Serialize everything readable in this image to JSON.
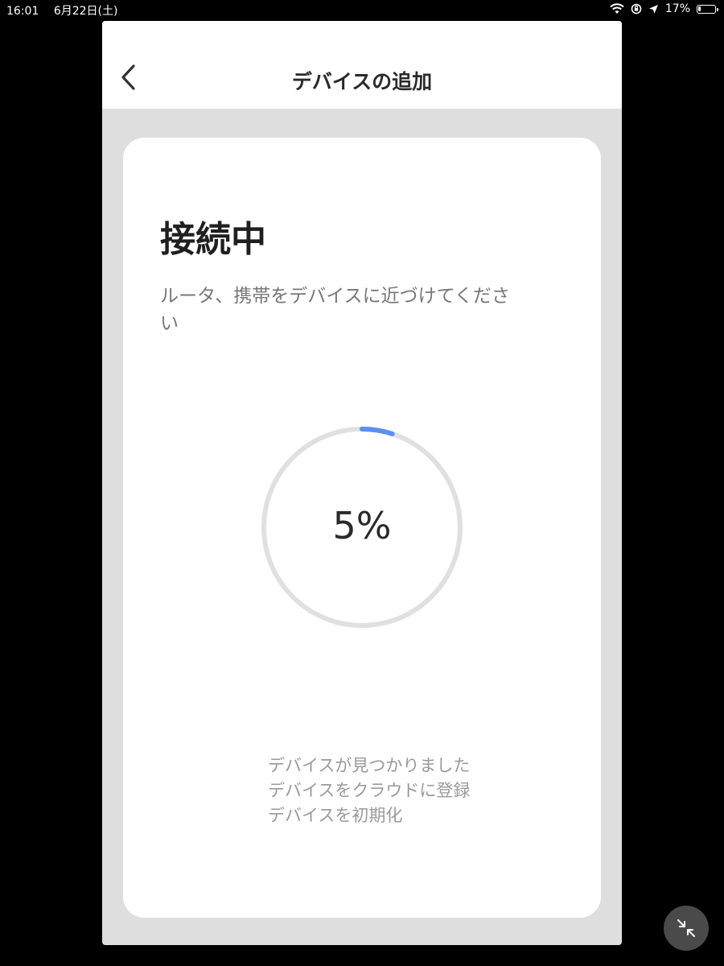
{
  "status_bar": {
    "time": "16:01",
    "date": "6月22日(土)",
    "battery_percent": "17%",
    "battery_level": 0.17
  },
  "nav": {
    "title": "デバイスの追加",
    "back_icon": "chevron-left-icon"
  },
  "card": {
    "heading": "接続中",
    "instruction": "ルータ、携帯をデバイスに近づけてください",
    "progress": {
      "label": "5%",
      "value": 0.05,
      "track_color": "#e0e0e0",
      "fill_color": "#5b8ff0"
    },
    "steps": [
      "デバイスが見つかりました",
      "デバイスをクラウドに登録",
      "デバイスを初期化"
    ]
  },
  "fab": {
    "icon": "collapse-arrows-icon"
  }
}
